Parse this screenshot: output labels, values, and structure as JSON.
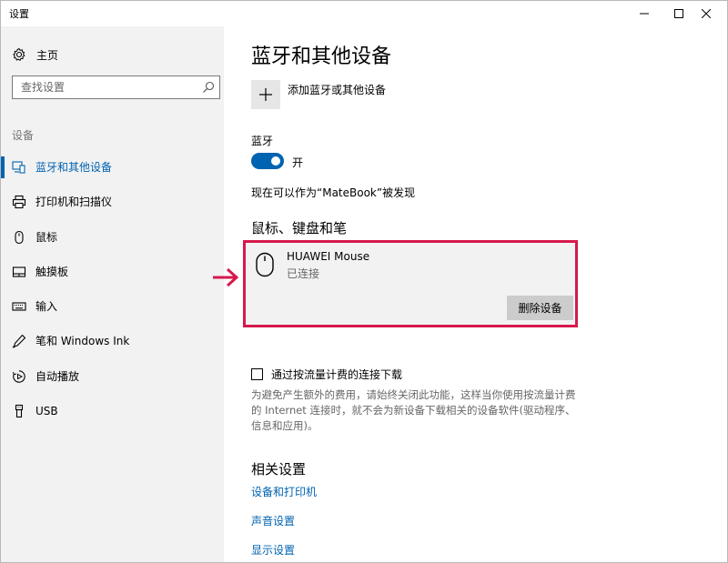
{
  "window": {
    "title": "设置",
    "controls": [
      "minimize-icon",
      "maximize-icon",
      "close-icon"
    ]
  },
  "sidebar": {
    "home_label": "主页",
    "search_placeholder": "查找设置",
    "section_label": "设备",
    "items": [
      {
        "label": "蓝牙和其他设备",
        "icon": "bluetooth-devices-icon",
        "active": true
      },
      {
        "label": "打印机和扫描仪",
        "icon": "printer-icon",
        "active": false
      },
      {
        "label": "鼠标",
        "icon": "mouse-icon",
        "active": false
      },
      {
        "label": "触摸板",
        "icon": "touchpad-icon",
        "active": false
      },
      {
        "label": "输入",
        "icon": "keyboard-icon",
        "active": false
      },
      {
        "label": "笔和 Windows Ink",
        "icon": "pen-icon",
        "active": false
      },
      {
        "label": "自动播放",
        "icon": "autoplay-icon",
        "active": false
      },
      {
        "label": "USB",
        "icon": "usb-icon",
        "active": false
      }
    ]
  },
  "main": {
    "title": "蓝牙和其他设备",
    "add_device_label": "添加蓝牙或其他设备",
    "bluetooth": {
      "label": "蓝牙",
      "state": "开",
      "on": true
    },
    "discoverable_text": "现在可以作为“MateBook”被发现",
    "mouse_section": {
      "heading": "鼠标、键盘和笔",
      "device": {
        "name": "HUAWEI Mouse",
        "status": "已连接",
        "remove_label": "删除设备"
      }
    },
    "metered": {
      "label": "通过按流量计费的连接下载",
      "checked": false,
      "description": "为避免产生额外的费用，请始终关闭此功能，这样当你使用按流量计费的 Internet 连接时，就不会为新设备下载相关的设备软件(驱动程序、信息和应用)。"
    },
    "related": {
      "heading": "相关设置",
      "links": [
        "设备和打印机",
        "声音设置",
        "显示设置"
      ]
    }
  },
  "colors": {
    "accent": "#0063b1",
    "highlight_border": "#d6194b",
    "sidebar_bg": "#f2f2f2"
  }
}
